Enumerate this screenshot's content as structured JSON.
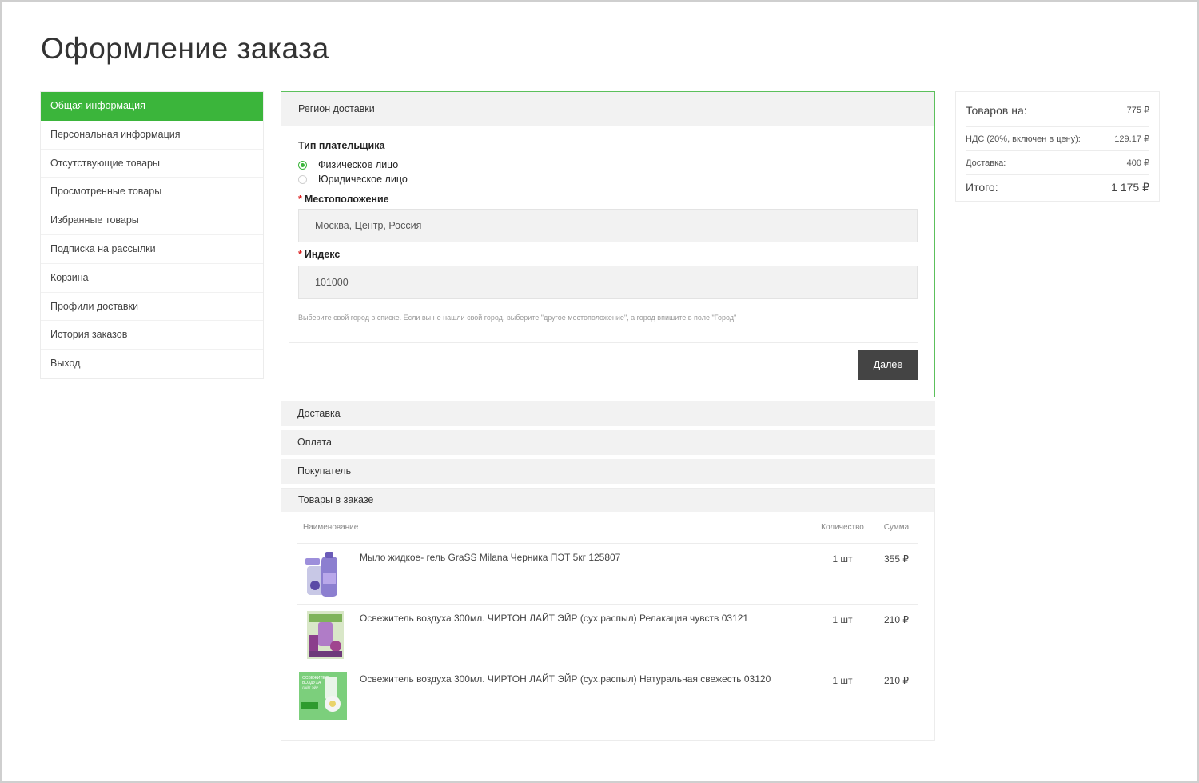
{
  "page": {
    "title": "Оформление заказа"
  },
  "sidebar": {
    "items": [
      {
        "label": "Общая информация",
        "active": true
      },
      {
        "label": "Персональная информация"
      },
      {
        "label": "Отсутствующие товары"
      },
      {
        "label": "Просмотренные товары"
      },
      {
        "label": "Избранные товары"
      },
      {
        "label": "Подписка на рассылки"
      },
      {
        "label": "Корзина"
      },
      {
        "label": "Профили доставки"
      },
      {
        "label": "История заказов"
      },
      {
        "label": "Выход"
      }
    ]
  },
  "region": {
    "header": "Регион доставки",
    "payer_type_label": "Тип плательщика",
    "payer_options": [
      {
        "label": "Физическое лицо",
        "checked": true
      },
      {
        "label": "Юридическое лицо",
        "checked": false
      }
    ],
    "location_label": "Местоположение",
    "location_value": "Москва, Центр, Россия",
    "index_label": "Индекс",
    "index_value": "101000",
    "required_mark": "*",
    "hint": "Выберите свой город в списке. Если вы не нашли свой город, выберите \"другое местоположение\", а город впишите в поле \"Город\"",
    "next_button": "Далее"
  },
  "sections": {
    "delivery": "Доставка",
    "payment": "Оплата",
    "buyer": "Покупатель",
    "products": "Товары в заказе"
  },
  "products": {
    "columns": {
      "name": "Наименование",
      "qty": "Количество",
      "sum": "Сумма"
    },
    "items": [
      {
        "name": "Мыло жидкое- гель GraSS Milana Черника ПЭТ 5кг 125807",
        "qty": "1 шт",
        "sum": "355 ₽",
        "image": "purple-soap-bottle"
      },
      {
        "name": "Освежитель воздуха 300мл. ЧИРТОН ЛАЙТ ЭЙР (сух.распыл) Релакация чувств 03121",
        "qty": "1 шт",
        "sum": "210 ₽",
        "image": "purple-air-freshener"
      },
      {
        "name": "Освежитель воздуха 300мл. ЧИРТОН ЛАЙТ ЭЙР (сух.распыл) Натуральная свежесть 03120",
        "qty": "1 шт",
        "sum": "210 ₽",
        "image": "green-air-freshener"
      }
    ],
    "image3_text": [
      "ОСВЕЖИТЕЛЬ",
      "ВОЗДУХА",
      "ЛАЙТ ЭЙР"
    ]
  },
  "summary": {
    "goods_label": "Товаров на:",
    "goods_value": "775 ₽",
    "vat_label": "НДС (20%, включен в цену):",
    "vat_value": "129.17 ₽",
    "delivery_label": "Доставка:",
    "delivery_value": "400 ₽",
    "total_label": "Итого:",
    "total_value": "1 175 ₽"
  },
  "colors": {
    "accent": "#3bb53b",
    "button": "#444444",
    "header_bg": "#f2f2f2"
  }
}
